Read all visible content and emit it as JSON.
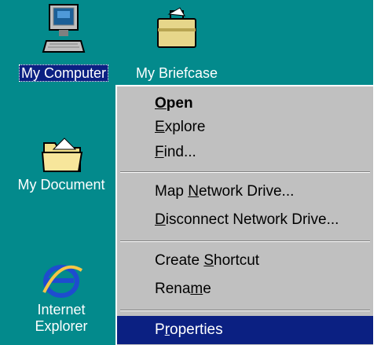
{
  "desktop": {
    "background_color": "#038a8c",
    "icons": [
      {
        "label": "My Computer",
        "icon": "my-computer-icon",
        "selected": true
      },
      {
        "label": "My Briefcase",
        "icon": "briefcase-icon"
      },
      {
        "label": "My Document",
        "icon": "folder-documents-icon"
      },
      {
        "label_line1": "Internet",
        "label_line2": "Explorer",
        "icon": "internet-explorer-icon"
      }
    ]
  },
  "context_menu": {
    "items": [
      {
        "before": "",
        "accel": "O",
        "after": "pen",
        "default": true
      },
      {
        "before": "",
        "accel": "E",
        "after": "xplore"
      },
      {
        "before": "",
        "accel": "F",
        "after": "ind..."
      },
      {
        "before": "Map ",
        "accel": "N",
        "after": "etwork Drive..."
      },
      {
        "before": "",
        "accel": "D",
        "after": "isconnect Network Drive..."
      },
      {
        "before": "Create ",
        "accel": "S",
        "after": "hortcut"
      },
      {
        "before": "Rena",
        "accel": "m",
        "after": "e"
      },
      {
        "before": "P",
        "accel": "r",
        "after": "operties",
        "highlighted": true
      }
    ],
    "highlight_color": "#0b2082"
  }
}
